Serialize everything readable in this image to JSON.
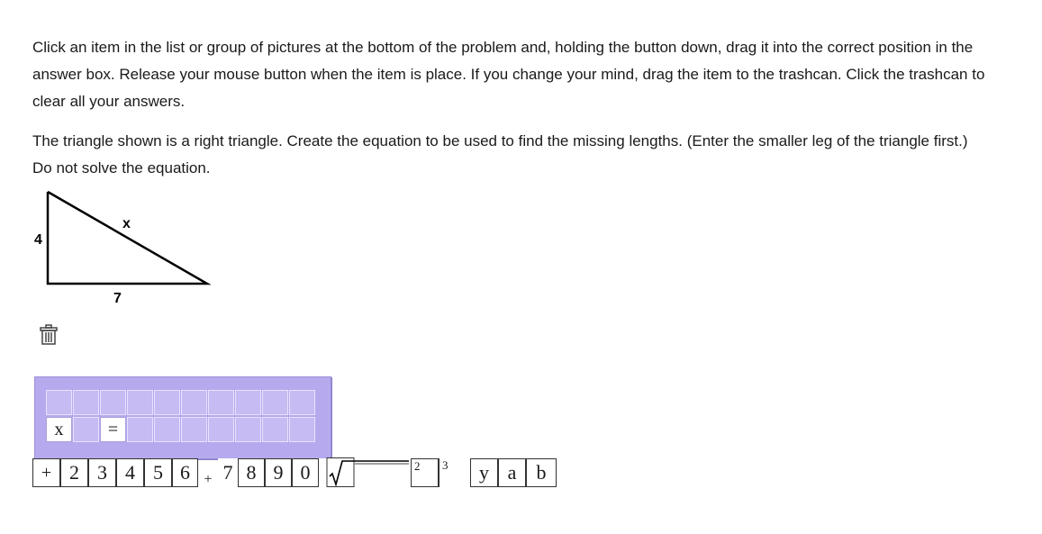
{
  "instructions": "Click an item in the list or group of pictures at the bottom of the problem and, holding the button down, drag it into the correct position in the answer box. Release your mouse button when the item is place. If you change your mind, drag the item to the trashcan. Click the trashcan to clear all your answers.",
  "prompt": "The triangle shown is a right triangle. Create the equation to be used to find the missing lengths. (Enter the smaller leg of the triangle first.) Do not solve the equation.",
  "triangle": {
    "leg_vertical": "4",
    "leg_horizontal": "7",
    "hypotenuse": "x"
  },
  "trash_icon": "trashcan-icon",
  "answer_box": {
    "row1": [
      "",
      "",
      "",
      "",
      "",
      "",
      "",
      "",
      "",
      "",
      ""
    ],
    "row2": [
      "x",
      "",
      "=",
      "",
      "",
      "",
      "",
      "",
      "",
      "",
      ""
    ]
  },
  "palette": {
    "plus": "+",
    "digits_a": [
      "2",
      "3",
      "4",
      "5",
      "6"
    ],
    "plus_small": "+",
    "digits_b": [
      "7",
      "8",
      "9",
      "0"
    ],
    "sqrt_icon": "square-root-icon",
    "exp2": "2",
    "exp3": "3",
    "vars": [
      "y",
      "a",
      "b"
    ]
  }
}
